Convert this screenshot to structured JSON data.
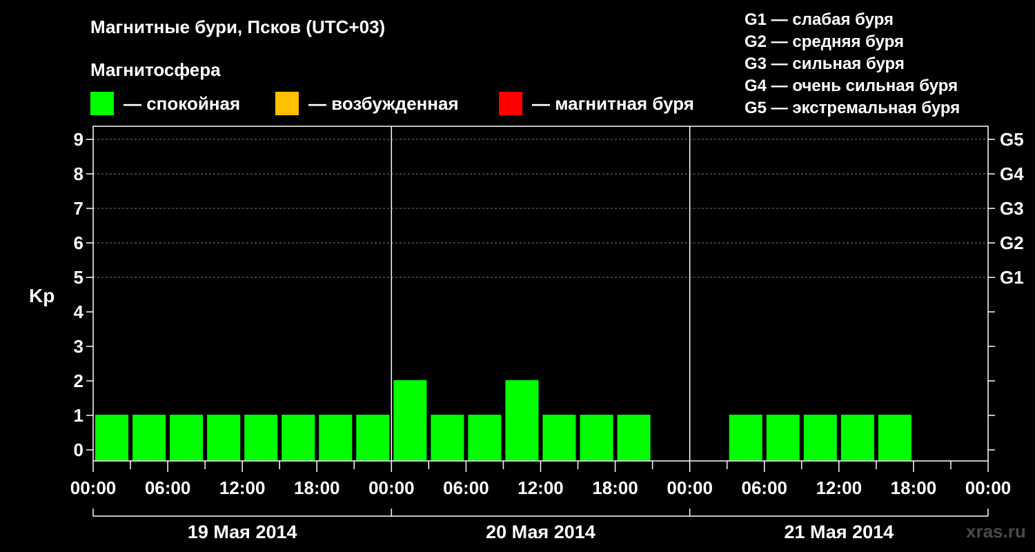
{
  "title": "Магнитные бури, Псков (UTC+03)",
  "subtitle": "Магнитосфера",
  "legend": [
    {
      "label": "— спокойная",
      "color": "#00ff00"
    },
    {
      "label": "— возбужденная",
      "color": "#ffc000"
    },
    {
      "label": "— магнитная буря",
      "color": "#ff0000"
    }
  ],
  "g_scale": [
    "G1 — слабая буря",
    "G2 — средняя буря",
    "G3 — сильная буря",
    "G4 — очень сильная буря",
    "G5 — экстремальная буря"
  ],
  "watermark": "xras.ru",
  "chart_data": {
    "type": "bar",
    "ylabel": "Kp",
    "ylim": [
      0,
      9
    ],
    "y_ticks": [
      "0",
      "1",
      "2",
      "3",
      "4",
      "5",
      "6",
      "7",
      "8",
      "9"
    ],
    "right_axis_labels": [
      {
        "kp": 5,
        "label": "G1"
      },
      {
        "kp": 6,
        "label": "G2"
      },
      {
        "kp": 7,
        "label": "G3"
      },
      {
        "kp": 8,
        "label": "G4"
      },
      {
        "kp": 9,
        "label": "G5"
      }
    ],
    "x_tick_labels": [
      "00:00",
      "06:00",
      "12:00",
      "18:00",
      "00:00",
      "06:00",
      "12:00",
      "18:00",
      "00:00",
      "06:00",
      "12:00",
      "18:00",
      "00:00"
    ],
    "days": [
      "19 Мая 2014",
      "20 Мая 2014",
      "21 Мая 2014"
    ],
    "interval_hours": 3,
    "grid": true,
    "bar_color": "#00ff00",
    "values": [
      1,
      1,
      1,
      1,
      1,
      1,
      1,
      1,
      2,
      1,
      1,
      2,
      1,
      1,
      1,
      null,
      null,
      1,
      1,
      1,
      1,
      1,
      null,
      null
    ]
  }
}
